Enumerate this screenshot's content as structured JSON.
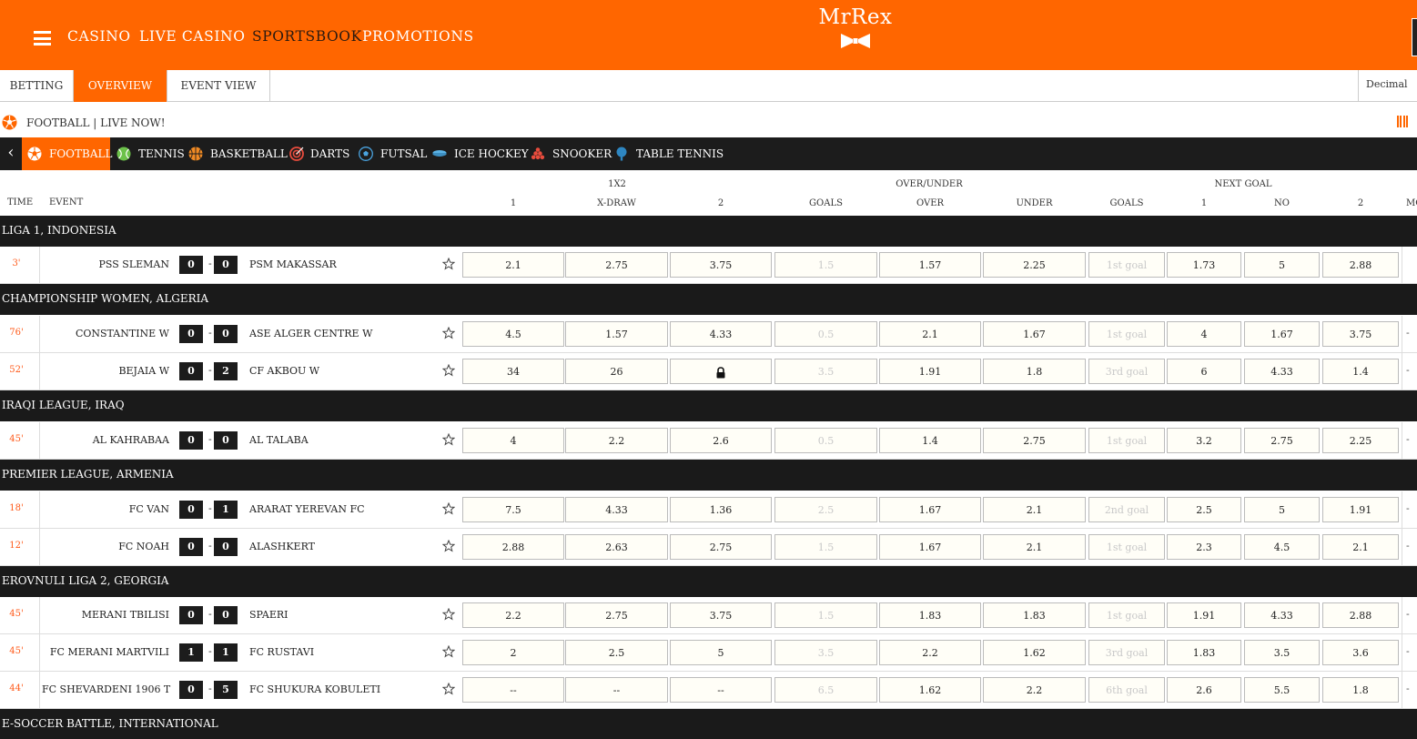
{
  "header": {
    "nav": [
      "CASINO",
      "LIVE CASINO",
      "SPORTSBOOK",
      "PROMOTIONS"
    ],
    "active_nav": "SPORTSBOOK",
    "logo_text": "MrRex"
  },
  "subtabs": {
    "items": [
      "BETTING",
      "OVERVIEW",
      "EVENT VIEW"
    ],
    "active": "OVERVIEW",
    "odds_format": "Decimal"
  },
  "live": {
    "label": "FOOTBALL | LIVE NOW!"
  },
  "sports": [
    {
      "label": "FOOTBALL",
      "icon": "football-icon",
      "active": true
    },
    {
      "label": "TENNIS",
      "icon": "tennis-icon",
      "active": false
    },
    {
      "label": "BASKETBALL",
      "icon": "basketball-icon",
      "active": false
    },
    {
      "label": "DARTS",
      "icon": "darts-icon",
      "active": false
    },
    {
      "label": "FUTSAL",
      "icon": "futsal-icon",
      "active": false
    },
    {
      "label": "ICE HOCKEY",
      "icon": "ice-hockey-icon",
      "active": false
    },
    {
      "label": "SNOOKER",
      "icon": "snooker-icon",
      "active": false
    },
    {
      "label": "TABLE TENNIS",
      "icon": "table-tennis-icon",
      "active": false
    }
  ],
  "table_header": {
    "groups": [
      "1X2",
      "OVER/UNDER",
      "NEXT GOAL"
    ],
    "time": "TIME",
    "event": "EVENT",
    "cols": [
      "1",
      "X-DRAW",
      "2",
      "GOALS",
      "OVER",
      "UNDER",
      "GOALS",
      "1",
      "NO",
      "2",
      "MO"
    ]
  },
  "leagues": [
    {
      "name": "LIGA 1, INDONESIA",
      "matches": [
        {
          "time": "3'",
          "home": "PSS SLEMAN",
          "hs": "0",
          "as": "0",
          "away": "PSM MAKASSAR",
          "odds": [
            "2.1",
            "2.75",
            "3.75",
            "1.5",
            "1.57",
            "2.25",
            "1st goal",
            "1.73",
            "5",
            "2.88"
          ],
          "more": ""
        }
      ]
    },
    {
      "name": "CHAMPIONSHIP WOMEN, ALGERIA",
      "matches": [
        {
          "time": "76'",
          "home": "CONSTANTINE W",
          "hs": "0",
          "as": "0",
          "away": "ASE ALGER CENTRE W",
          "odds": [
            "4.5",
            "1.57",
            "4.33",
            "0.5",
            "2.1",
            "1.67",
            "1st goal",
            "4",
            "1.67",
            "3.75"
          ],
          "more": "-"
        },
        {
          "time": "52'",
          "home": "BEJAIA W",
          "hs": "0",
          "as": "2",
          "away": "CF AKBOU W",
          "odds": [
            "34",
            "26",
            "",
            "3.5",
            "1.91",
            "1.8",
            "3rd goal",
            "6",
            "4.33",
            "1.4"
          ],
          "locked": 2,
          "more": "-"
        }
      ]
    },
    {
      "name": "IRAQI LEAGUE, IRAQ",
      "matches": [
        {
          "time": "45'",
          "home": "AL KAHRABAA",
          "hs": "0",
          "as": "0",
          "away": "AL TALABA",
          "odds": [
            "4",
            "2.2",
            "2.6",
            "0.5",
            "1.4",
            "2.75",
            "1st goal",
            "3.2",
            "2.75",
            "2.25"
          ],
          "more": "-"
        }
      ]
    },
    {
      "name": "PREMIER LEAGUE, ARMENIA",
      "matches": [
        {
          "time": "18'",
          "home": "FC VAN",
          "hs": "0",
          "as": "1",
          "away": "ARARAT YEREVAN FC",
          "odds": [
            "7.5",
            "4.33",
            "1.36",
            "2.5",
            "1.67",
            "2.1",
            "2nd goal",
            "2.5",
            "5",
            "1.91"
          ],
          "more": "-"
        },
        {
          "time": "12'",
          "home": "FC NOAH",
          "hs": "0",
          "as": "0",
          "away": "ALASHKERT",
          "odds": [
            "2.88",
            "2.63",
            "2.75",
            "1.5",
            "1.67",
            "2.1",
            "1st goal",
            "2.3",
            "4.5",
            "2.1"
          ],
          "more": "-"
        }
      ]
    },
    {
      "name": "EROVNULI LIGA 2, GEORGIA",
      "matches": [
        {
          "time": "45'",
          "home": "MERANI TBILISI",
          "hs": "0",
          "as": "0",
          "away": "SPAERI",
          "odds": [
            "2.2",
            "2.75",
            "3.75",
            "1.5",
            "1.83",
            "1.83",
            "1st goal",
            "1.91",
            "4.33",
            "2.88"
          ],
          "more": "-"
        },
        {
          "time": "45'",
          "home": "FC MERANI MARTVILI",
          "hs": "1",
          "as": "1",
          "away": "FC RUSTAVI",
          "odds": [
            "2",
            "2.5",
            "5",
            "3.5",
            "2.2",
            "1.62",
            "3rd goal",
            "1.83",
            "3.5",
            "3.6"
          ],
          "more": "-"
        },
        {
          "time": "44'",
          "home": "FC SHEVARDENI 1906 T",
          "hs": "0",
          "as": "5",
          "away": "FC SHUKURA KOBULETI",
          "odds": [
            "--",
            "--",
            "--",
            "6.5",
            "1.62",
            "2.2",
            "6th goal",
            "2.6",
            "5.5",
            "1.8"
          ],
          "more": "-"
        }
      ]
    },
    {
      "name": "E-SOCCER BATTLE, INTERNATIONAL",
      "matches": []
    }
  ],
  "colors": {
    "brand": "#ff6600",
    "dark": "#1c1c1c",
    "time": "#ff5a1a"
  }
}
